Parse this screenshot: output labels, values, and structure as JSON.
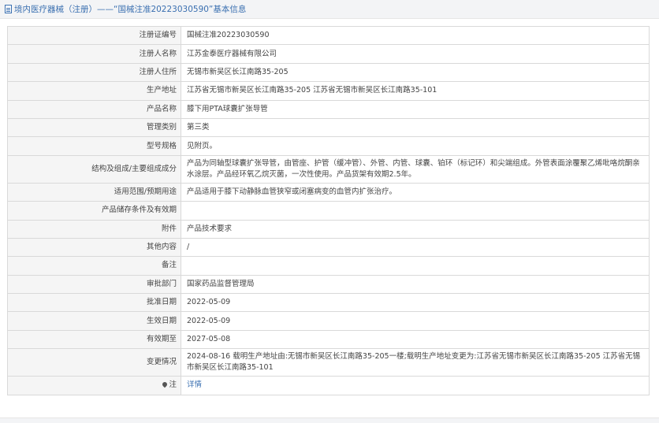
{
  "header": {
    "title": "境内医疗器械（注册）——“国械注准20223030590”基本信息"
  },
  "rows": [
    {
      "label": "注册证编号",
      "value": "国械注准20223030590"
    },
    {
      "label": "注册人名称",
      "value": "江苏金泰医疗器械有限公司"
    },
    {
      "label": "注册人住所",
      "value": "无锡市新吴区长江南路35-205"
    },
    {
      "label": "生产地址",
      "value": "江苏省无锡市新吴区长江南路35-205 江苏省无锡市新吴区长江南路35-101"
    },
    {
      "label": "产品名称",
      "value": "膝下用PTA球囊扩张导管"
    },
    {
      "label": "管理类别",
      "value": "第三类"
    },
    {
      "label": "型号规格",
      "value": "见附页。"
    },
    {
      "label": "结构及组成/主要组成成分",
      "value": "产品为同轴型球囊扩张导管，由管座、护管（缓冲管）、外管、内管、球囊、铂环（标记环）和尖端组成。外管表面涂覆聚乙烯吡咯烷酮亲水涂层。产品经环氧乙烷灭菌，一次性使用。产品货架有效期2.5年。"
    },
    {
      "label": "适用范围/预期用途",
      "value": "产品适用于膝下动静脉血管狭窄或闭塞病变的血管内扩张治疗。"
    },
    {
      "label": "产品储存条件及有效期",
      "value": ""
    },
    {
      "label": "附件",
      "value": "产品技术要求"
    },
    {
      "label": "其他内容",
      "value": "/"
    },
    {
      "label": "备注",
      "value": ""
    },
    {
      "label": "审批部门",
      "value": "国家药品监督管理局"
    },
    {
      "label": "批准日期",
      "value": "2022-05-09"
    },
    {
      "label": "生效日期",
      "value": "2022-05-09"
    },
    {
      "label": "有效期至",
      "value": "2027-05-08"
    },
    {
      "label": "变更情况",
      "value": "2024-08-16 载明生产地址由:无锡市新吴区长江南路35-205一楼;载明生产地址变更为:江苏省无锡市新吴区长江南路35-205 江苏省无锡市新吴区长江南路35-101"
    },
    {
      "label": "注",
      "value": "详情"
    }
  ],
  "icons": {
    "header_icon": "document-icon",
    "note_icon": "pin-icon"
  },
  "colors": {
    "link": "#3a6fb0",
    "label_bg": "#f5f5f5",
    "border": "#d9d9d9"
  }
}
